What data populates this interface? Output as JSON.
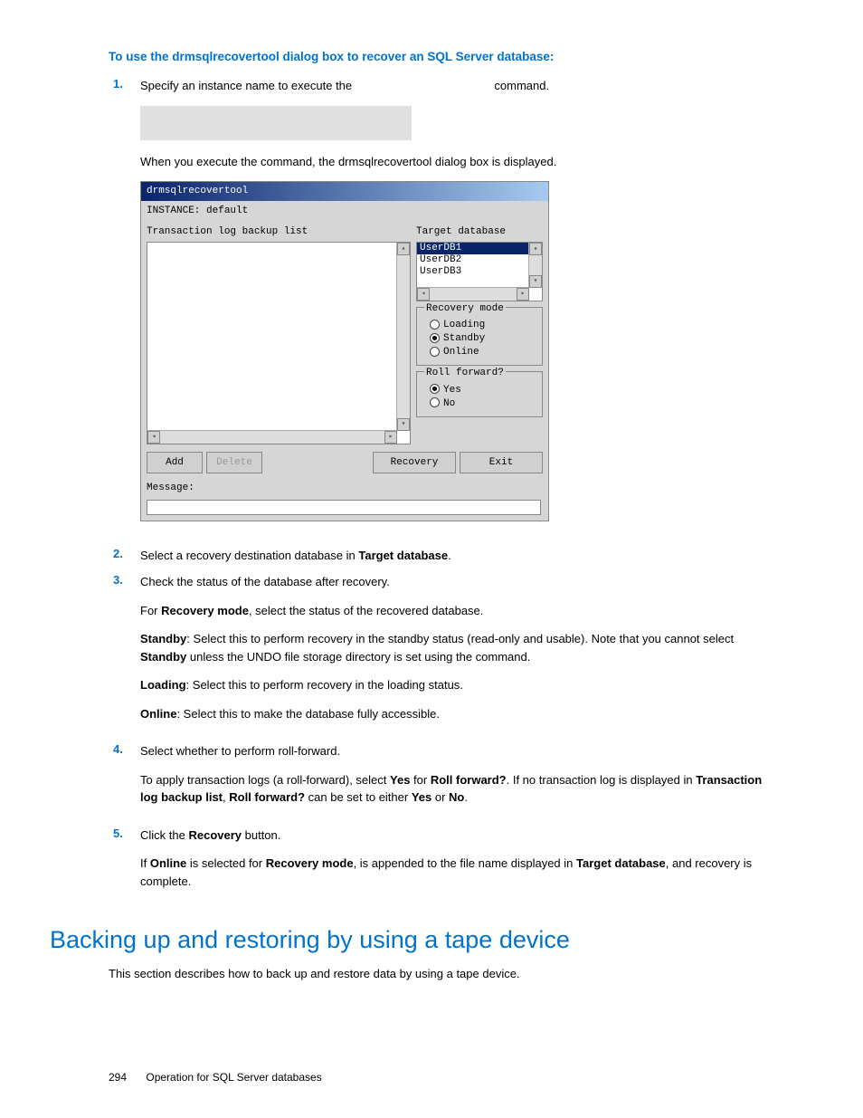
{
  "heading1": "To use the drmsqlrecovertool dialog box to recover an SQL Server database:",
  "steps": {
    "s1_num": "1.",
    "s1_a": "Specify an instance name to execute the ",
    "s1_b": " command.",
    "s1_c": "When you execute the command, the drmsqlrecovertool dialog box is displayed.",
    "s2_num": "2.",
    "s2_a": "Select a recovery destination database in ",
    "s2_b": "Target database",
    "s2_c": ".",
    "s3_num": "3.",
    "s3_a": "Check the status of the database after recovery.",
    "s3_p1_a": "For ",
    "s3_p1_b": "Recovery mode",
    "s3_p1_c": ", select the status of the recovered database.",
    "s3_p2_a": "Standby",
    "s3_p2_b": ": Select this to perform recovery in the standby status (read-only and usable). Note that you cannot select ",
    "s3_p2_c": "Standby",
    "s3_p2_d": " unless the UNDO file storage directory is set using the command.",
    "s3_p3_a": "Loading",
    "s3_p3_b": ": Select this to perform recovery in the loading status.",
    "s3_p4_a": "Online",
    "s3_p4_b": ": Select this to make the database fully accessible.",
    "s4_num": "4.",
    "s4_a": "Select whether to perform roll-forward.",
    "s4_p1_a": "To apply transaction logs (a roll-forward), select ",
    "s4_p1_b": "Yes",
    "s4_p1_c": " for ",
    "s4_p1_d": "Roll forward?",
    "s4_p1_e": ". If no transaction log is displayed in ",
    "s4_p1_f": "Transaction log backup list",
    "s4_p1_g": ", ",
    "s4_p1_h": "Roll forward?",
    "s4_p1_i": " can be set to either ",
    "s4_p1_j": "Yes",
    "s4_p1_k": " or ",
    "s4_p1_l": "No",
    "s4_p1_m": ".",
    "s5_num": "5.",
    "s5_a": "Click the ",
    "s5_b": "Recovery",
    "s5_c": " button.",
    "s5_p1_a": "If ",
    "s5_p1_b": "Online",
    "s5_p1_c": " is selected for ",
    "s5_p1_d": "Recovery mode",
    "s5_p1_e": ",    is appended to the file name displayed in ",
    "s5_p1_f": "Target database",
    "s5_p1_g": ", and recovery is complete."
  },
  "dialog": {
    "title": "drmsqlrecovertool",
    "instance": "INSTANCE: default",
    "tx_label": "Transaction log backup list",
    "target_label": "Target database",
    "db1": "UserDB1",
    "db2": "UserDB2",
    "db3": "UserDB3",
    "recovery_legend": "Recovery mode",
    "r_loading": "Loading",
    "r_standby": "Standby",
    "r_online": "Online",
    "rf_legend": "Roll forward?",
    "rf_yes": "Yes",
    "rf_no": "No",
    "btn_add": "Add",
    "btn_delete": "Delete",
    "btn_recovery": "Recovery",
    "btn_exit": "Exit",
    "msg_label": "Message:"
  },
  "section2": "Backing up and restoring by using a tape device",
  "section2_p": "This section describes how to back up and restore data by using a tape device.",
  "footer_page": "294",
  "footer_text": "Operation for SQL Server databases"
}
